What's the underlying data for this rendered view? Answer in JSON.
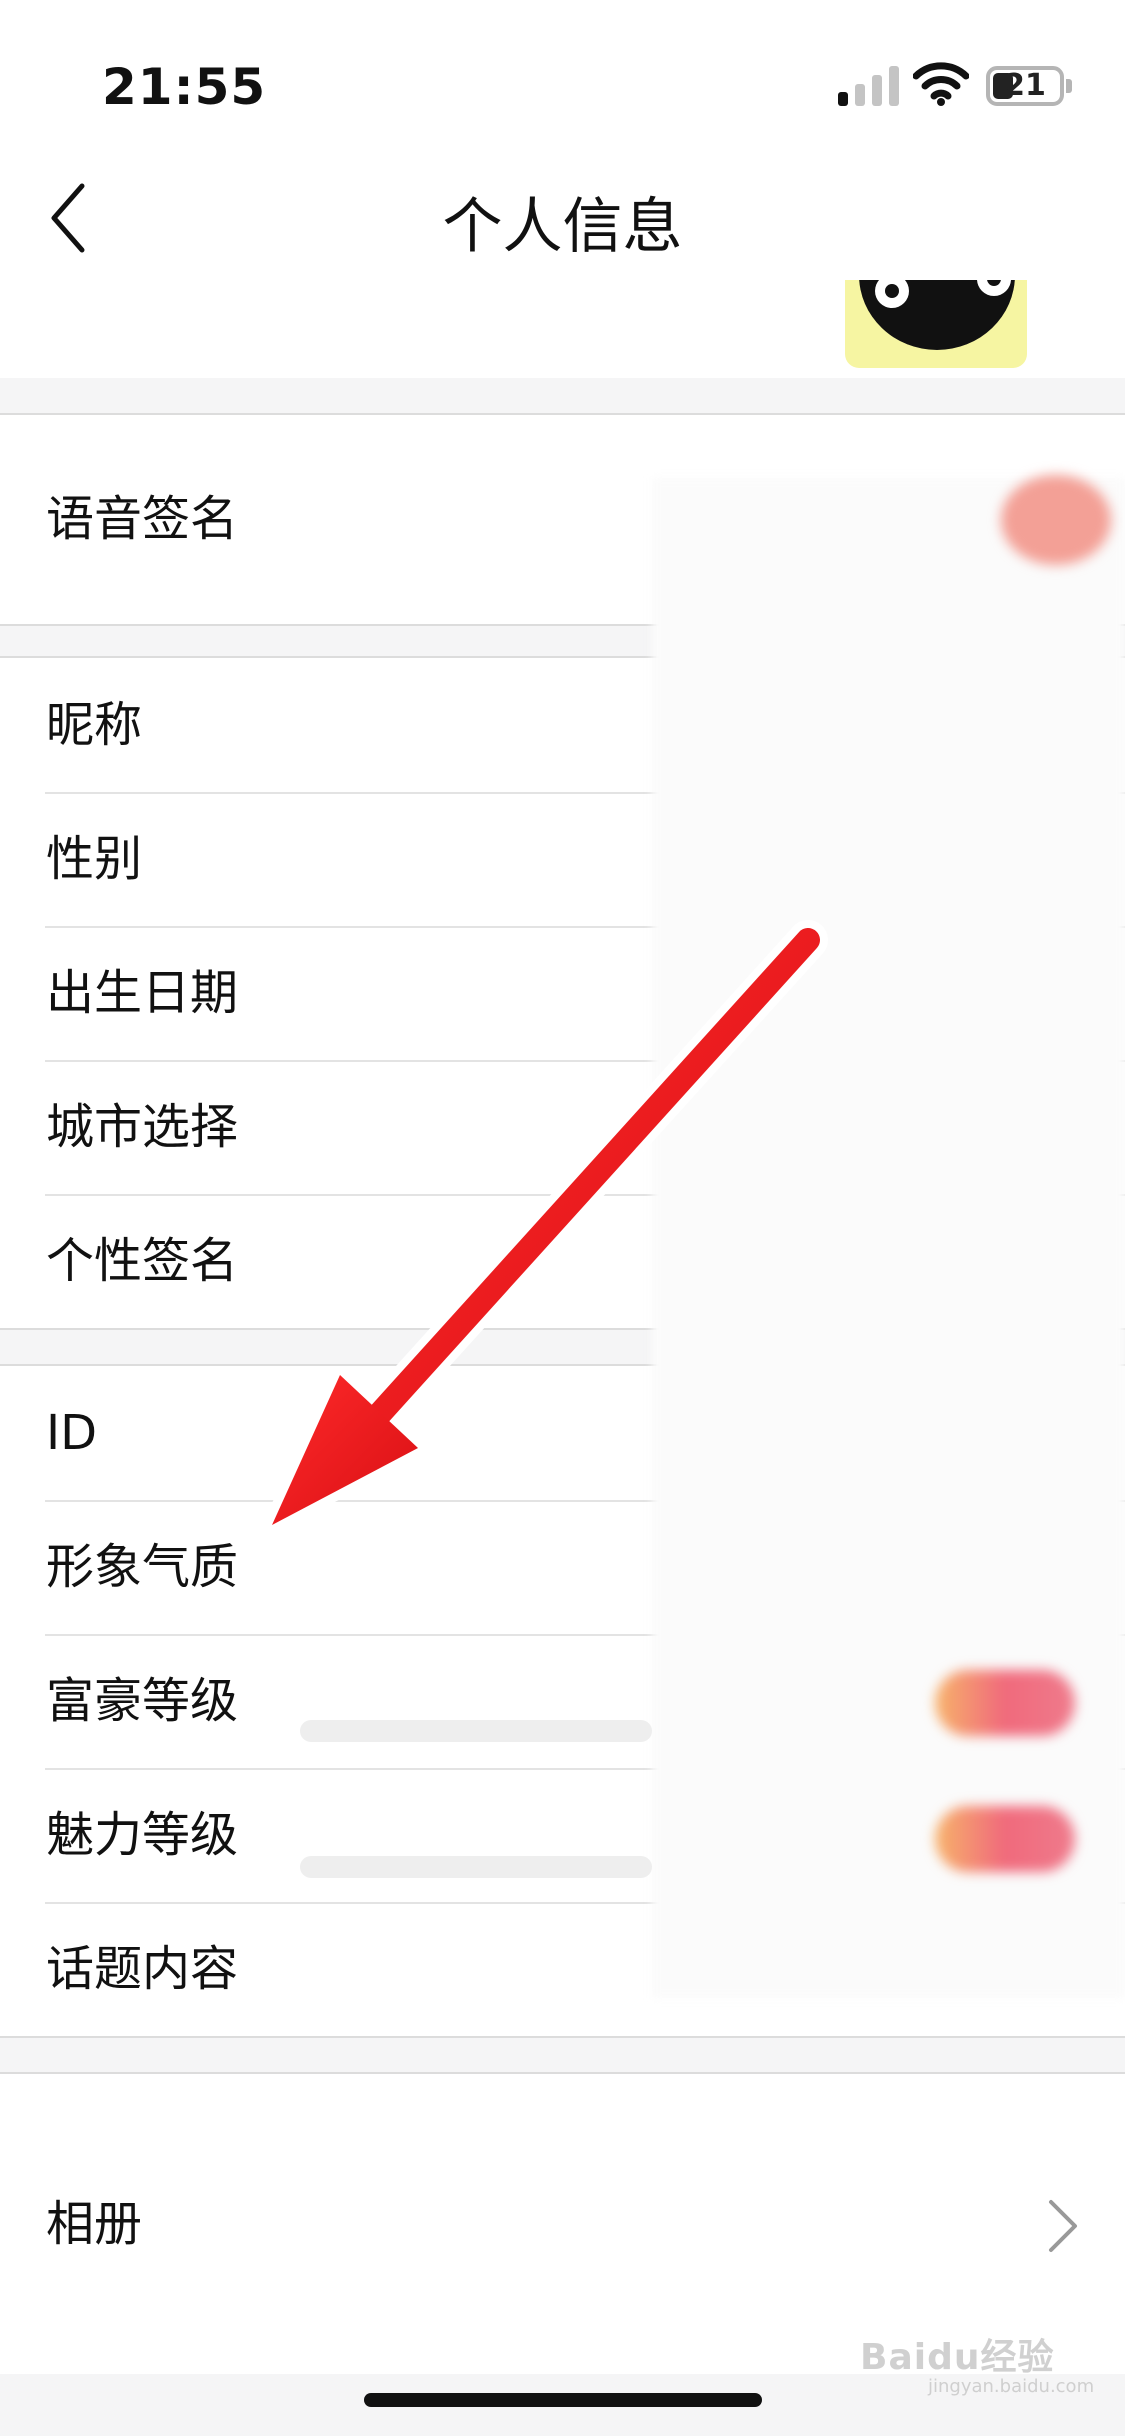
{
  "status_bar": {
    "time": "21:55",
    "battery": "21"
  },
  "nav": {
    "title": "个人信息"
  },
  "sections": [
    {
      "rows": [
        {
          "label": "语音签名"
        }
      ]
    },
    {
      "rows": [
        {
          "label": "昵称"
        },
        {
          "label": "性别"
        },
        {
          "label": "出生日期"
        },
        {
          "label": "城市选择"
        },
        {
          "label": "个性签名"
        }
      ]
    },
    {
      "rows": [
        {
          "label": "ID"
        },
        {
          "label": "形象气质"
        },
        {
          "label": "富豪等级"
        },
        {
          "label": "魅力等级"
        },
        {
          "label": "话题内容"
        }
      ]
    }
  ],
  "album": {
    "label": "相册"
  },
  "colors": {
    "arrow": "#e8141a",
    "background": "#f5f5f6",
    "card": "#ffffff"
  },
  "watermark": {
    "brand": "Baidu经验",
    "domain": "jingyan.baidu.com"
  }
}
